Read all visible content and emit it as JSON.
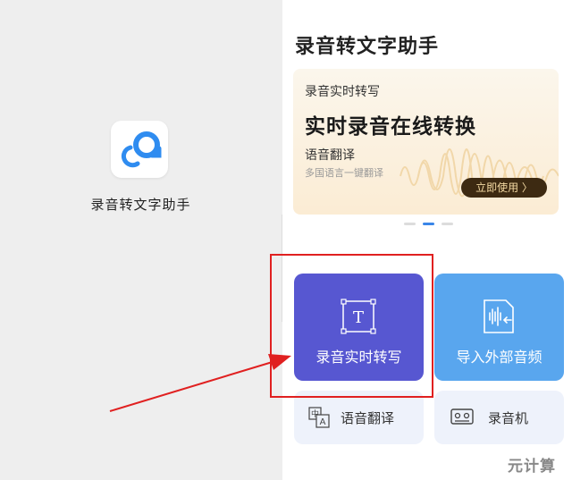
{
  "launcher": {
    "app_name": "录音转文字助手",
    "icon": "app-logo-icon"
  },
  "app": {
    "title": "录音转文字助手",
    "banner": {
      "subtitle": "录音实时转写",
      "headline": "实时录音在线转换",
      "feature": "语音翻译",
      "description": "多国语言一键翻译",
      "cta": "立即使用 〉"
    },
    "carousel": {
      "count": 3,
      "active": 1
    },
    "tiles": [
      {
        "label": "录音实时转写",
        "icon": "text-frame-icon",
        "color": "#5757d1"
      },
      {
        "label": "导入外部音频",
        "icon": "import-audio-file-icon",
        "color": "#59a6ee"
      },
      {
        "label": "语音翻译",
        "icon": "translate-icon"
      },
      {
        "label": "录音机",
        "icon": "tape-recorder-icon"
      }
    ]
  },
  "annotation": {
    "highlight_color": "#e02020"
  },
  "watermark": "元计算"
}
